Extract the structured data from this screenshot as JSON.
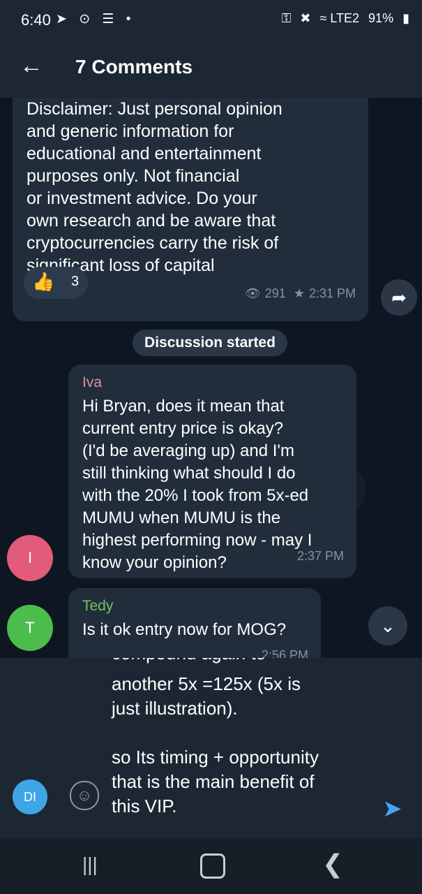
{
  "status_bar": {
    "time": "6:40",
    "left_icons": "➤ ⊙ ☰ •",
    "right_icons": [
      "⚿",
      "✖",
      "≈ LTE2",
      "91%"
    ],
    "battery": "▮"
  },
  "header": {
    "back_icon": "←",
    "title": "7 Comments"
  },
  "post": {
    "text": "Disclaimer: Just personal opinion\nand generic information for\neducational and entertainment\npurposes only. Not financial\nor investment advice. Do your\nown research and be aware that\ncryptocurrencies carry the risk of\nsignificant loss of capital",
    "reaction_emoji": "👍",
    "reaction_count": "3",
    "views": "291",
    "views_icon": "👁",
    "pin_icon": "★",
    "time": "2:31 PM",
    "share_icon": "➦"
  },
  "divider": {
    "label": "Discussion started"
  },
  "messages": [
    {
      "sender": "Iva",
      "avatar_initial": "I",
      "avatar_color": "#e25b78",
      "text": "Hi Bryan, does it mean that\ncurrent entry price is okay?\n(I'd be averaging up) and I'm\nstill thinking what should I do\nwith the 20% I took from 5x-ed\nMUMU when MUMU is the\nhighest performing now - may I\nknow your opinion?",
      "time": "2:37 PM"
    },
    {
      "sender": "Tedy",
      "avatar_initial": "T",
      "avatar_color": "#4cbd4c",
      "text": "Is it ok entry now for MOG?",
      "time": "2:56 PM"
    }
  ],
  "scroll_down_icon": "⌄",
  "composer": {
    "clipped_line": "compound again to",
    "text": "another 5x =125x (5x is\njust illustration).\n\nso Its timing + opportunity\nthat is the main benefit of\nthis VIP.",
    "avatar_initials": "DI",
    "emoji_icon": "☺",
    "send_icon": "➤"
  },
  "nav": {
    "recent_icon": "|||",
    "back_icon": "❮"
  }
}
